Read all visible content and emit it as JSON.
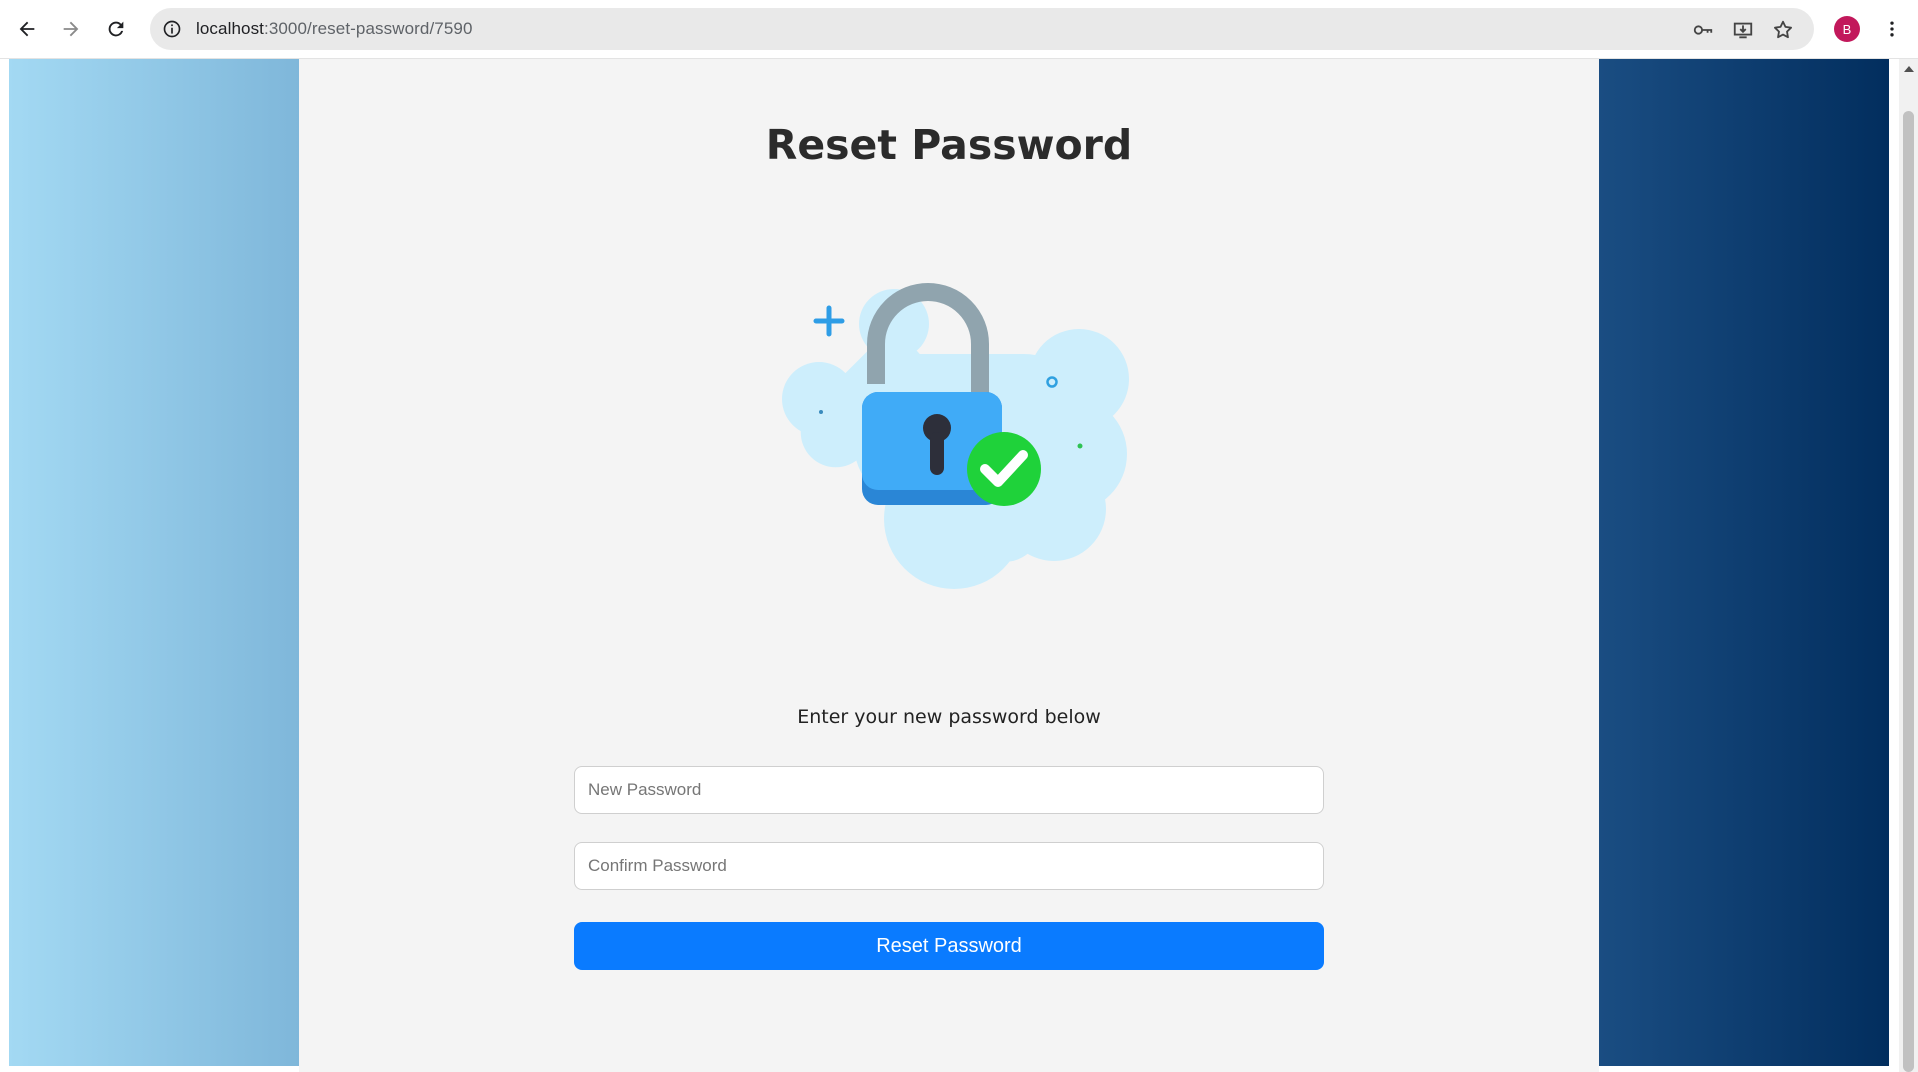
{
  "browser": {
    "url_host": "localhost",
    "url_path": ":3000/reset-password/7590",
    "avatar_letter": "B",
    "icons": [
      "back-arrow-icon",
      "forward-arrow-icon",
      "reload-icon",
      "site-info-icon",
      "password-key-icon",
      "install-app-icon",
      "bookmark-star-icon",
      "more-menu-icon"
    ]
  },
  "page": {
    "title": "Reset Password",
    "subtitle": "Enter your new password below",
    "new_password_placeholder": "New Password",
    "confirm_password_placeholder": "Confirm Password",
    "submit_label": "Reset Password",
    "illustration": "unlocked-padlock-checkmark-illustration"
  },
  "colors": {
    "left_panel": "#a3d9f3",
    "right_panel": "#022e5e",
    "button": "#0a7bff",
    "panel_bg": "#f4f4f4",
    "check_green": "#22d12f",
    "lock_blue": "#3fa9f5"
  }
}
